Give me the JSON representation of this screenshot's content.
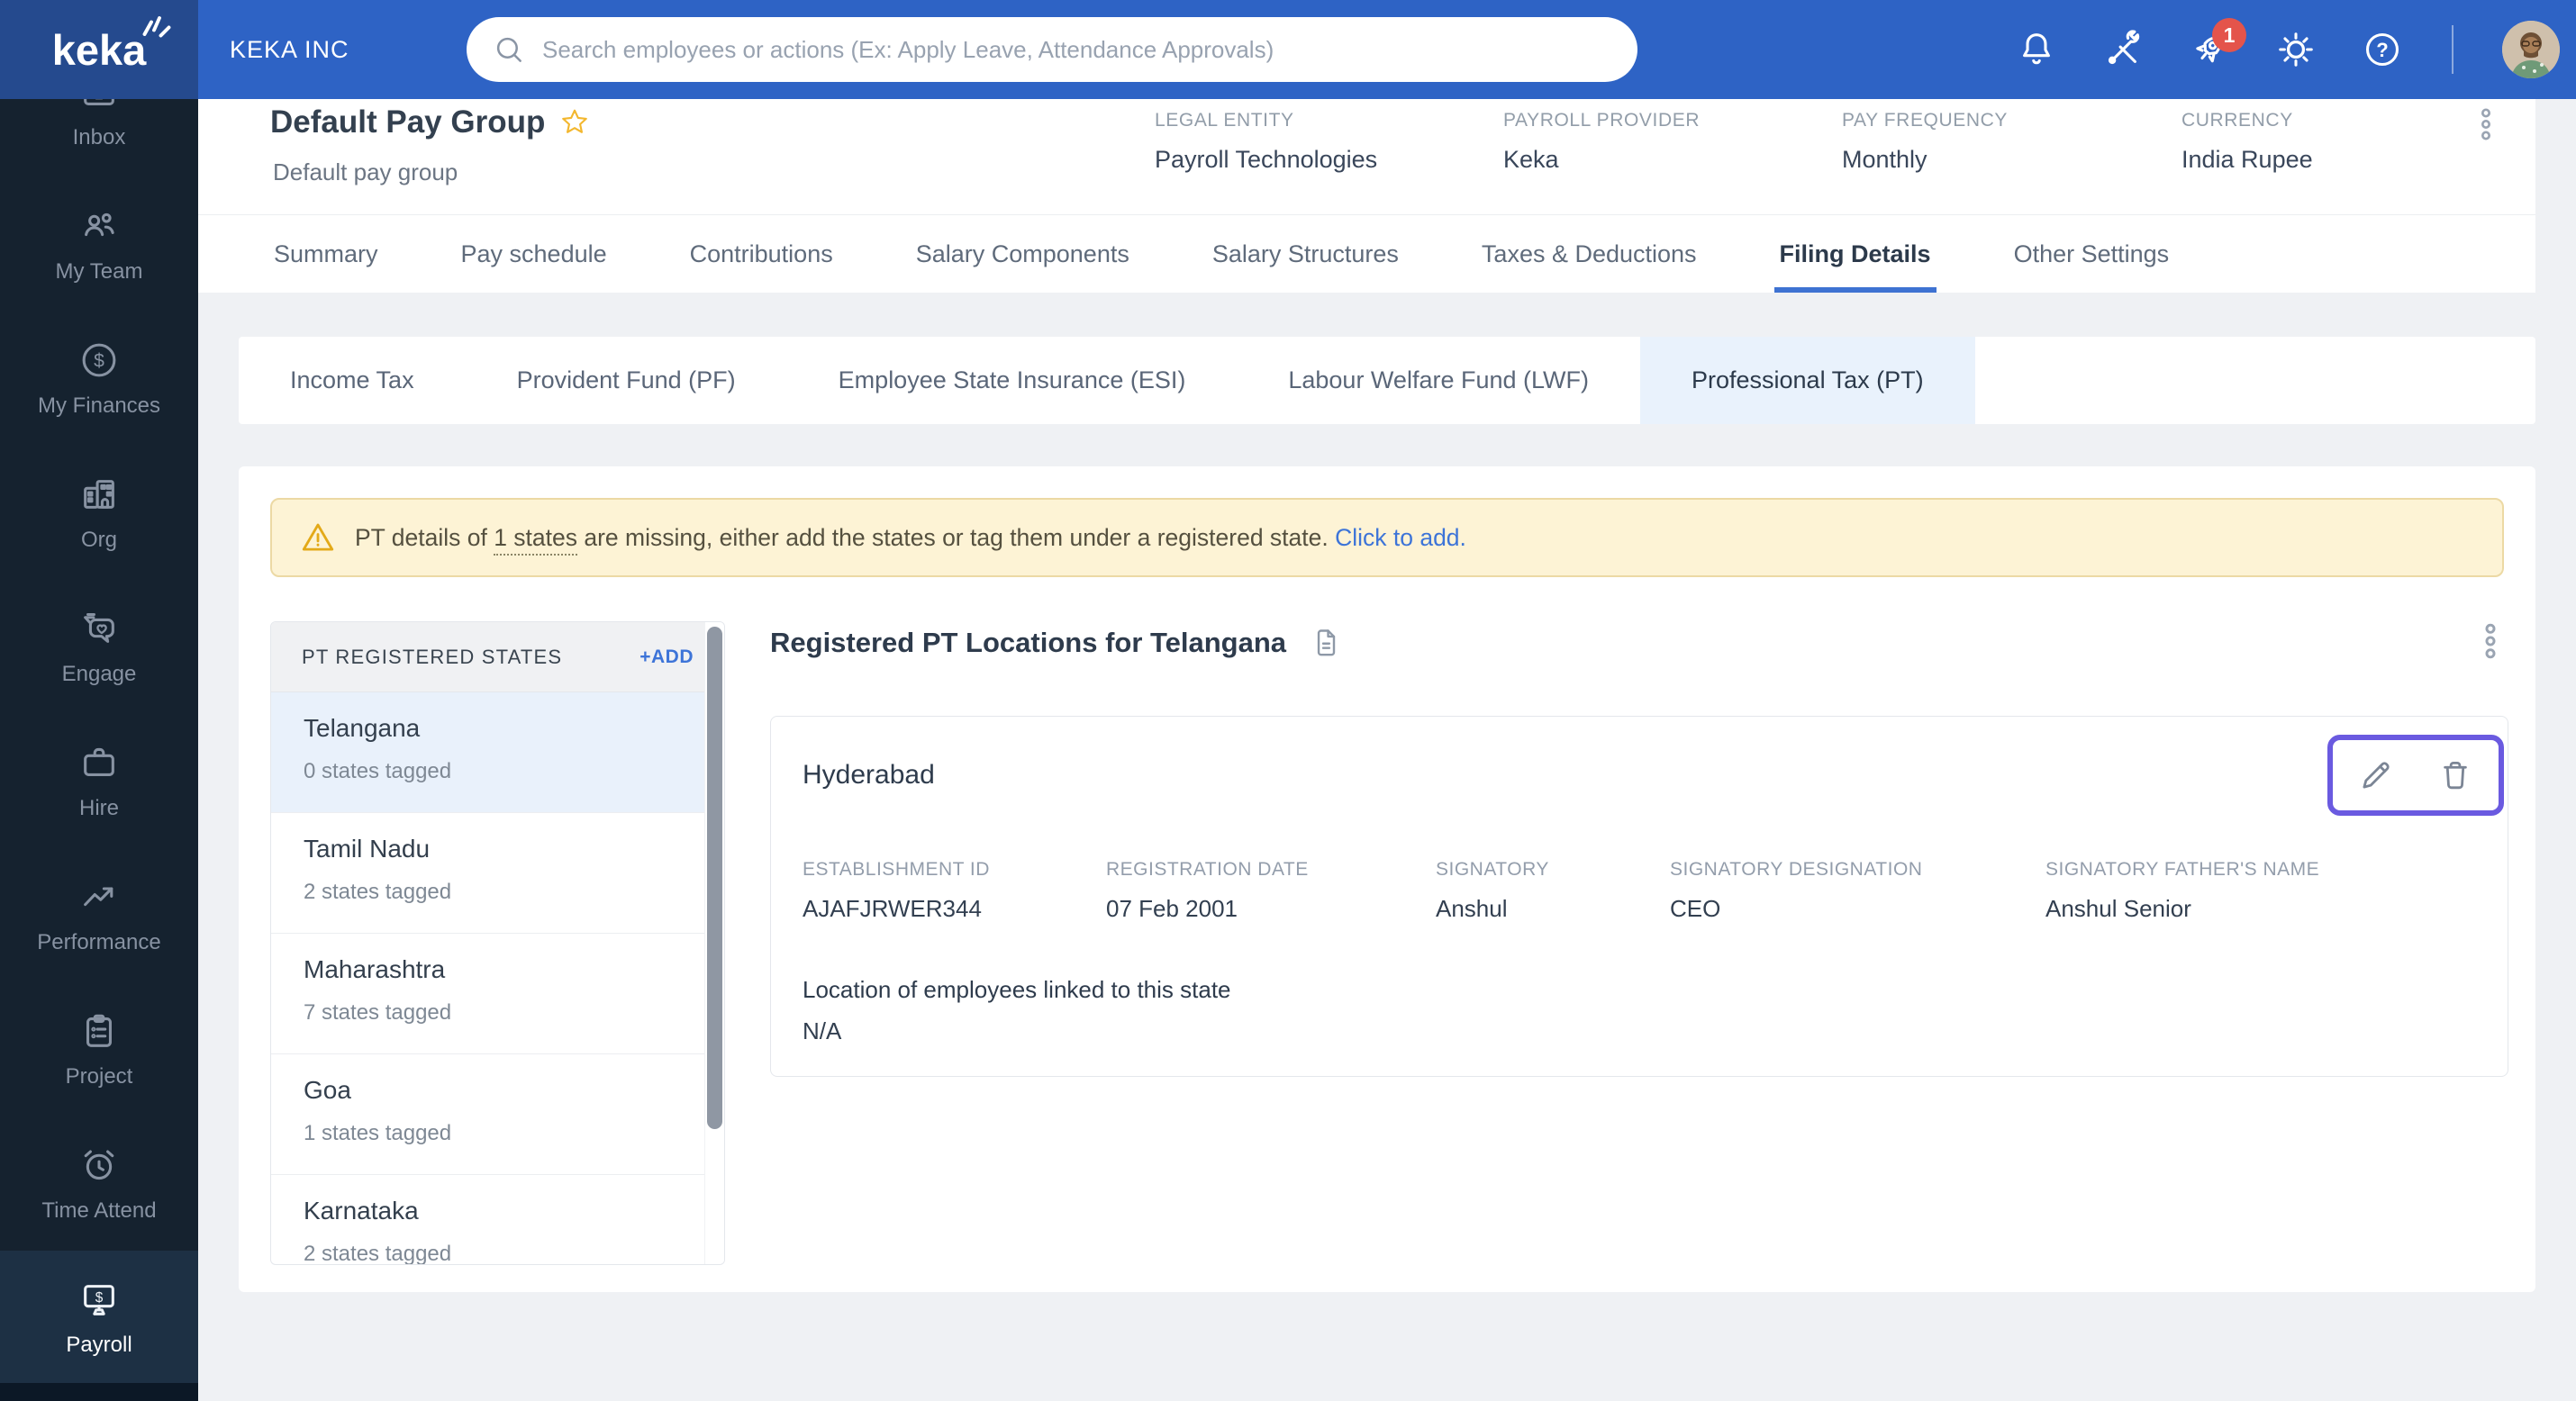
{
  "topbar": {
    "logo_text": "keka",
    "company": "KEKA INC",
    "search_placeholder": "Search employees or actions (Ex: Apply Leave, Attendance Approvals)",
    "notification_count": "1",
    "icons": [
      "bell",
      "tools",
      "rocket",
      "settings",
      "help"
    ]
  },
  "sidebar": {
    "items": [
      {
        "label": "Inbox",
        "icon": "inbox-icon"
      },
      {
        "label": "My Team",
        "icon": "my-team-icon"
      },
      {
        "label": "My Finances",
        "icon": "my-finances-icon"
      },
      {
        "label": "Org",
        "icon": "org-icon"
      },
      {
        "label": "Engage",
        "icon": "engage-icon"
      },
      {
        "label": "Hire",
        "icon": "hire-icon"
      },
      {
        "label": "Performance",
        "icon": "performance-icon"
      },
      {
        "label": "Project",
        "icon": "project-icon"
      },
      {
        "label": "Time Attend",
        "icon": "time-attend-icon"
      },
      {
        "label": "Payroll",
        "icon": "payroll-icon"
      }
    ],
    "active": "Payroll"
  },
  "header": {
    "title": "Default Pay Group",
    "subtitle": "Default pay group",
    "fields": [
      {
        "label": "LEGAL ENTITY",
        "value": "Payroll Technologies"
      },
      {
        "label": "PAYROLL PROVIDER",
        "value": "Keka"
      },
      {
        "label": "PAY FREQUENCY",
        "value": "Monthly"
      },
      {
        "label": "CURRENCY",
        "value": "India Rupee"
      }
    ]
  },
  "tabs": {
    "items": [
      "Summary",
      "Pay schedule",
      "Contributions",
      "Salary Components",
      "Salary Structures",
      "Taxes & Deductions",
      "Filing Details",
      "Other Settings"
    ],
    "active": "Filing Details"
  },
  "subtabs": {
    "items": [
      "Income Tax",
      "Provident Fund (PF)",
      "Employee State Insurance (ESI)",
      "Labour Welfare Fund (LWF)",
      "Professional Tax (PT)"
    ],
    "active": "Professional Tax (PT)"
  },
  "warning": {
    "prefix": "PT details of ",
    "underlined": "1 states",
    "suffix": " are missing, either add the states or tag them under a registered state. ",
    "link": "Click to add."
  },
  "states_panel": {
    "header": "PT REGISTERED STATES",
    "add_label": "+ADD",
    "items": [
      {
        "name": "Telangana",
        "tagged": "0 states tagged",
        "selected": true
      },
      {
        "name": "Tamil Nadu",
        "tagged": "2 states tagged",
        "selected": false
      },
      {
        "name": "Maharashtra",
        "tagged": "7 states tagged",
        "selected": false
      },
      {
        "name": "Goa",
        "tagged": "1 states tagged",
        "selected": false
      },
      {
        "name": "Karnataka",
        "tagged": "2 states tagged",
        "selected": false
      }
    ]
  },
  "content": {
    "title": "Registered PT Locations for Telangana",
    "location": {
      "name": "Hyderabad",
      "fields": [
        {
          "label": "ESTABLISHMENT ID",
          "value": "AJAFJRWER344"
        },
        {
          "label": "REGISTRATION DATE",
          "value": "07 Feb 2001"
        },
        {
          "label": "SIGNATORY",
          "value": "Anshul"
        },
        {
          "label": "SIGNATORY DESIGNATION",
          "value": "CEO"
        },
        {
          "label": "SIGNATORY FATHER'S NAME",
          "value": "Anshul Senior"
        }
      ],
      "linked_label": "Location of employees linked to this state",
      "linked_value": "N/A"
    }
  },
  "colors": {
    "topbar_blue": "#2e63c5",
    "logo_navy": "#254a8e",
    "sidebar_navy": "#15222f",
    "sidebar_active": "#1d3044",
    "accent_blue": "#3d74d8",
    "tab_underline": "#3e72d2",
    "selected_row_blue": "#e9f1fb",
    "subtab_active_bg": "#e9f2fc",
    "warning_bg": "#fdf3d5",
    "warning_border": "#ecd9a4",
    "warning_icon": "#e3a918",
    "badge_red": "#e4544b",
    "highlight_purple": "#6a5ae0",
    "star_yellow": "#f3b72e"
  }
}
